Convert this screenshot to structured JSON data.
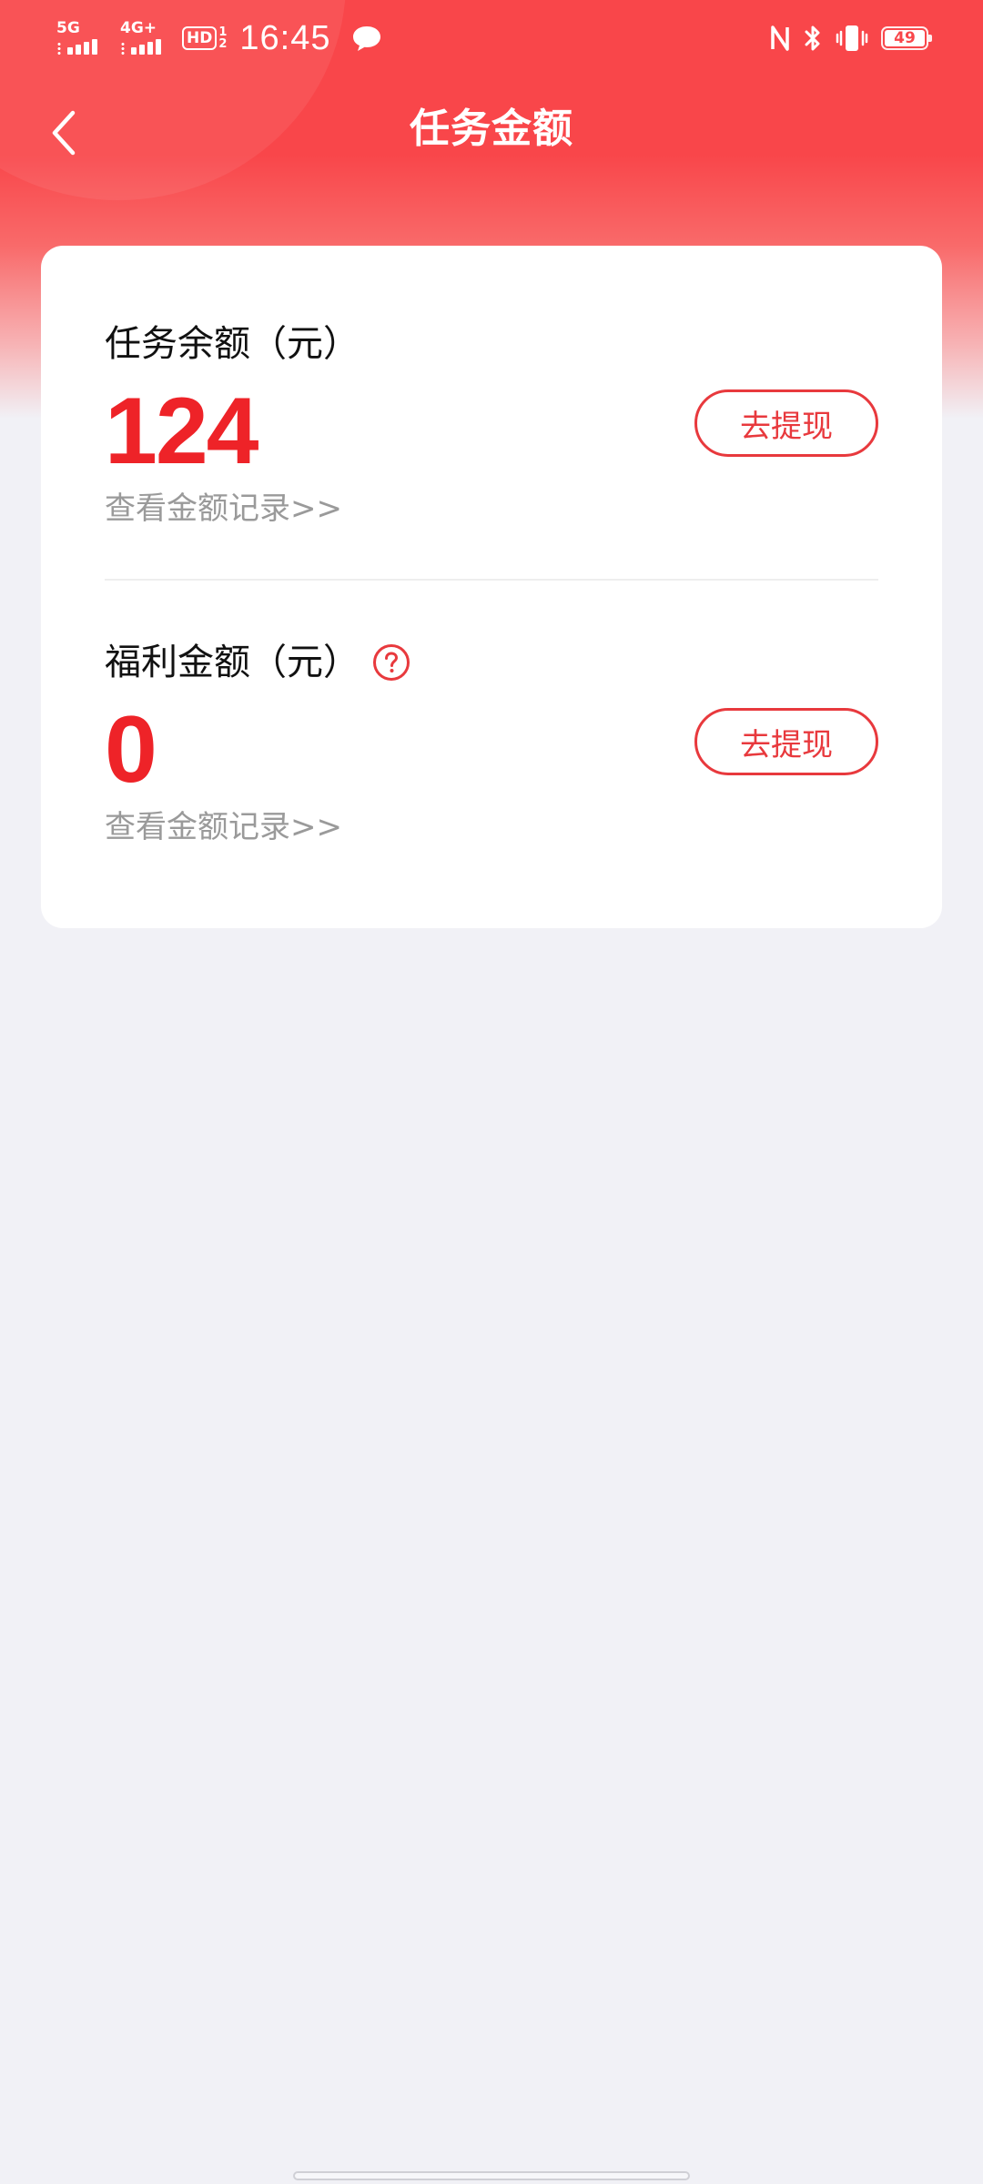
{
  "status_bar": {
    "network_1": "5G",
    "network_2": "4G+",
    "hd_label": "HD",
    "hd_sub_1": "1",
    "hd_sub_2": "2",
    "time": "16:45",
    "battery_percent": "49",
    "battery_level": 0.49,
    "icons": [
      "signal-icon",
      "chat-bubble-icon",
      "nfc-icon",
      "bluetooth-icon",
      "vibrate-icon",
      "battery-icon"
    ]
  },
  "nav": {
    "title": "任务金额",
    "back_icon": "chevron-left-icon"
  },
  "colors": {
    "accent": "#ee2328",
    "header_red": "#f9464a",
    "background": "#f1f1f6"
  },
  "task_balance": {
    "title": "任务余额（元）",
    "amount": "124",
    "record_link": "查看金额记录>>",
    "button": "去提现"
  },
  "welfare_balance": {
    "title": "福利金额（元）",
    "help_icon": "question-circle-icon",
    "amount": "0",
    "record_link": "查看金额记录>>",
    "button": "去提现"
  }
}
